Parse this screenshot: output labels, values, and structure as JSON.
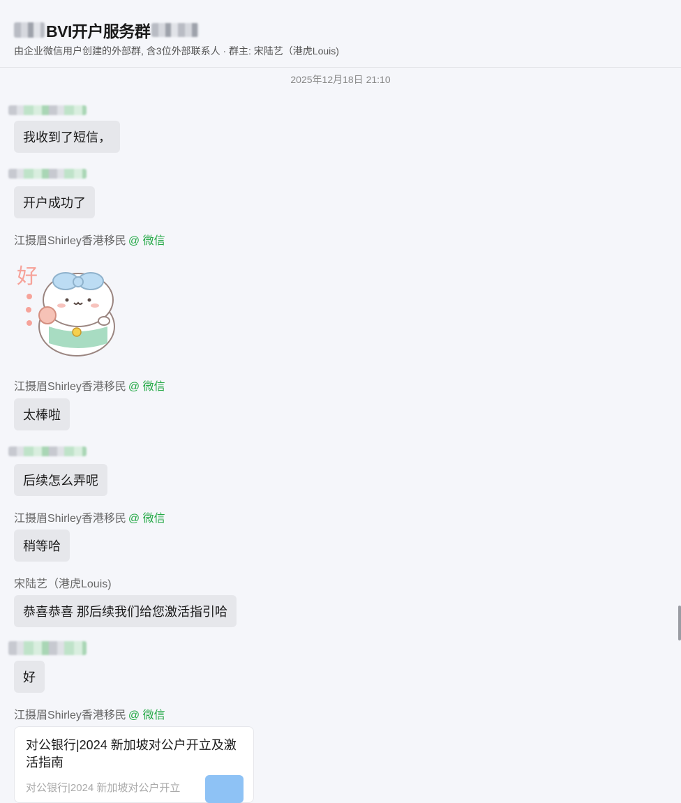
{
  "header": {
    "title": "BVI开户服务群",
    "subtitle": "由企业微信用户创建的外部群, 含3位外部联系人 · 群主: 宋陆艺（港虎Louis)"
  },
  "timestamp": "2025年12月18日 21:10",
  "messages": [
    {
      "sender": "",
      "sender_blurred": true,
      "text": "我收到了短信，"
    },
    {
      "sender": "",
      "sender_blurred": true,
      "text": "开户成功了"
    },
    {
      "sender": "江摄眉Shirley香港移民",
      "tag": "@ 微信",
      "type": "sticker",
      "sticker_label": "好"
    },
    {
      "sender": "江摄眉Shirley香港移民",
      "tag": "@ 微信",
      "text": "太棒啦"
    },
    {
      "sender": "",
      "sender_blurred": true,
      "text": "后续怎么弄呢"
    },
    {
      "sender": "江摄眉Shirley香港移民",
      "tag": "@ 微信",
      "text": "稍等哈"
    },
    {
      "sender": "宋陆艺（港虎Louis)",
      "text": "恭喜恭喜 那后续我们给您激活指引哈"
    },
    {
      "sender": "",
      "sender_blurred": true,
      "text": "好"
    },
    {
      "sender": "江摄眉Shirley香港移民",
      "tag": "@ 微信",
      "type": "link",
      "link_title": "对公银行|2024 新加坡对公户开立及激活指南",
      "link_desc": "对公银行|2024 新加坡对公户开立"
    }
  ],
  "colors": {
    "background": "#f5f6fa",
    "bubble": "#e6e7eb",
    "wechat_tag": "#23a845",
    "sender_text": "#666666"
  }
}
